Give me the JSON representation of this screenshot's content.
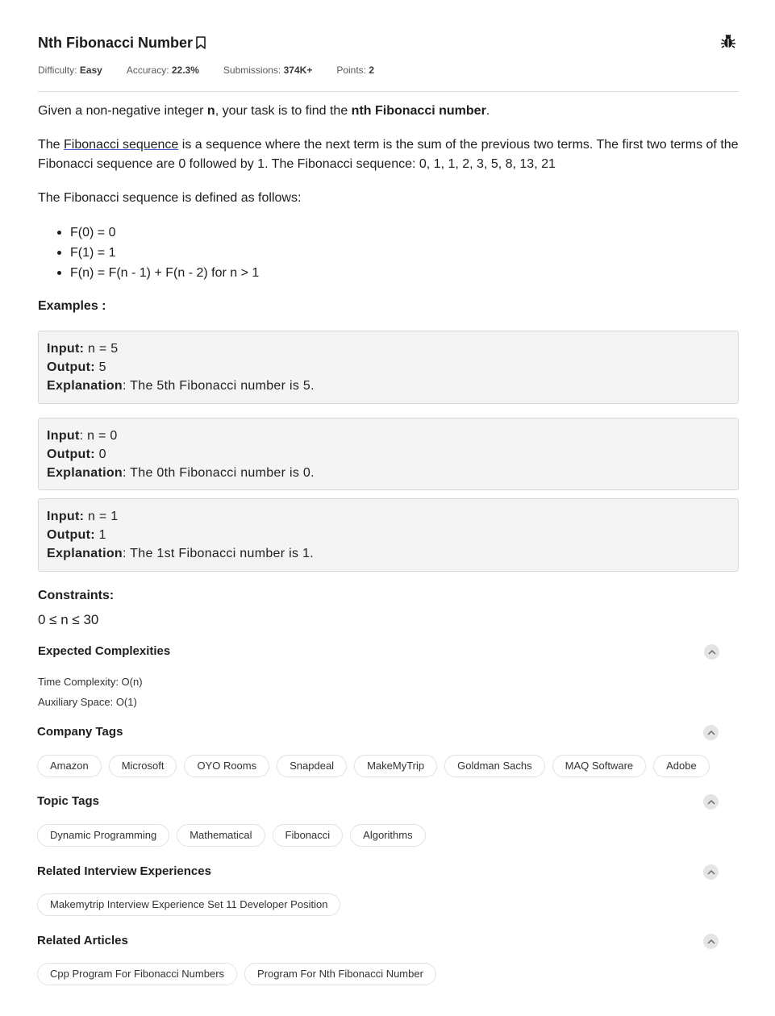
{
  "problem": {
    "title": "Nth Fibonacci Number",
    "difficulty_label": "Difficulty:",
    "difficulty": "Easy",
    "accuracy_label": "Accuracy:",
    "accuracy": "22.3%",
    "submissions_label": "Submissions:",
    "submissions": "374K+",
    "points_label": "Points:",
    "points": "2"
  },
  "description": {
    "p1_a": "Given a non-negative integer ",
    "p1_n": "n",
    "p1_b": ", your task is to find the ",
    "p1_c": "nth Fibonacci number",
    "p1_d": ".",
    "p2_a": "The ",
    "p2_link": "Fibonacci sequence",
    "p2_b": " is a sequence where the next term is the sum of the previous two terms. The first two terms of the Fibonacci sequence are 0 followed by 1. The Fibonacci sequence: 0, 1, 1, 2, 3, 5, 8, 13, 21",
    "p3": "The Fibonacci sequence is defined as follows:",
    "bullets": [
      "F(0) = 0",
      "F(1) = 1",
      "F(n) = F(n - 1) + F(n - 2) for n > 1"
    ]
  },
  "examples": {
    "heading": "Examples :",
    "items": [
      {
        "input_label": "Input:",
        "input": " n = 5",
        "output_label": "Output:",
        "output": " 5",
        "explanation_label": "Explanation",
        "explanation": ": The 5th Fibonacci number is 5."
      },
      {
        "input_label": "Input",
        "input": ": n = 0",
        "output_label": "Output:",
        "output": " 0",
        "explanation_label": "Explanation",
        "explanation": ": The 0th Fibonacci number is 0."
      },
      {
        "input_label": "Input:",
        "input": " n = 1",
        "output_label": "Output:",
        "output": " 1",
        "explanation_label": "Explanation",
        "explanation": ": The 1st Fibonacci number is 1."
      }
    ]
  },
  "constraints": {
    "heading": "Constraints:",
    "value": "0 ≤ n ≤ 30"
  },
  "complexities": {
    "heading": "Expected Complexities",
    "time": "Time Complexity: O(n)",
    "space": "Auxiliary Space: O(1)"
  },
  "company_tags": {
    "heading": "Company Tags",
    "items": [
      "Amazon",
      "Microsoft",
      "OYO Rooms",
      "Snapdeal",
      "MakeMyTrip",
      "Goldman Sachs",
      "MAQ Software",
      "Adobe"
    ]
  },
  "topic_tags": {
    "heading": "Topic Tags",
    "items": [
      "Dynamic Programming",
      "Mathematical",
      "Fibonacci",
      "Algorithms"
    ]
  },
  "interview_experiences": {
    "heading": "Related Interview Experiences",
    "items": [
      "Makemytrip Interview Experience Set 11 Developer Position"
    ]
  },
  "related_articles": {
    "heading": "Related Articles",
    "items": [
      "Cpp Program For Fibonacci Numbers",
      "Program For Nth Fibonacci Number"
    ]
  },
  "icons": {
    "bookmark": "bookmark-icon",
    "bug": "bug-icon",
    "collapse": "chevron-up-icon"
  }
}
